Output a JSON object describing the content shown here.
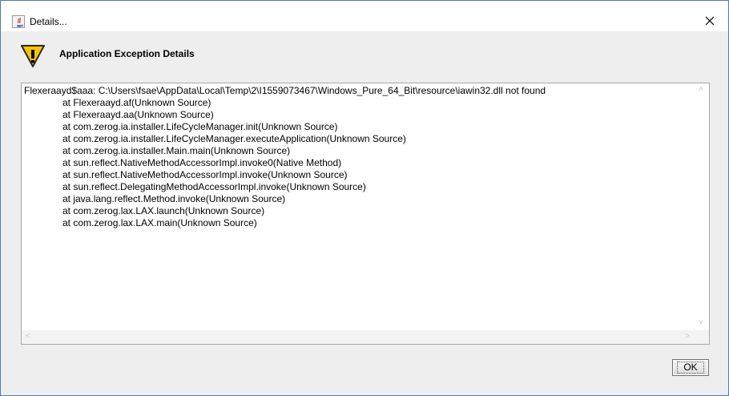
{
  "window": {
    "title": "Details...",
    "app_icon": "java-cup-icon",
    "close_icon": "close-icon"
  },
  "header": {
    "icon": "warning-icon",
    "title": "Application Exception Details"
  },
  "details_text": "Flexeraayd$aaa: C:\\Users\\fsae\\AppData\\Local\\Temp\\2\\I1559073467\\Windows_Pure_64_Bit\\resource\\iawin32.dll not found\n\tat Flexeraayd.af(Unknown Source)\n\tat Flexeraayd.aa(Unknown Source)\n\tat com.zerog.ia.installer.LifeCycleManager.init(Unknown Source)\n\tat com.zerog.ia.installer.LifeCycleManager.executeApplication(Unknown Source)\n\tat com.zerog.ia.installer.Main.main(Unknown Source)\n\tat sun.reflect.NativeMethodAccessorImpl.invoke0(Native Method)\n\tat sun.reflect.NativeMethodAccessorImpl.invoke(Unknown Source)\n\tat sun.reflect.DelegatingMethodAccessorImpl.invoke(Unknown Source)\n\tat java.lang.reflect.Method.invoke(Unknown Source)\n\tat com.zerog.lax.LAX.launch(Unknown Source)\n\tat com.zerog.lax.LAX.main(Unknown Source)",
  "buttons": {
    "ok_label": "OK"
  },
  "colors": {
    "warning_fill": "#f5c400",
    "window_border": "#4a7ab8"
  }
}
